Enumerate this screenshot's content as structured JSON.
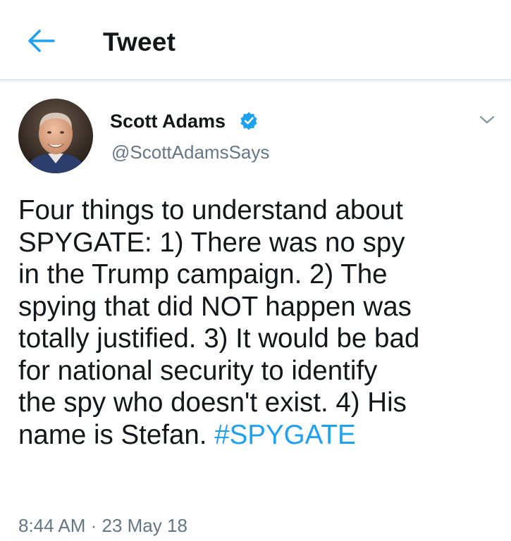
{
  "header": {
    "back_icon": "arrow-left-icon",
    "title": "Tweet",
    "accent_color": "#1da1f2"
  },
  "tweet": {
    "author": {
      "name": "Scott Adams",
      "handle": "@ScottAdamsSays",
      "verified": true,
      "verified_icon": "verified-badge-icon"
    },
    "menu_icon": "chevron-down-icon",
    "text_lines": [
      "Four things to understand about",
      "SPYGATE: 1) There was no spy",
      "in the Trump campaign. 2) The",
      "spying that did NOT happen was",
      "totally justified. 3) It would be bad",
      "for national security to identify",
      "the spy who doesn't exist. 4) His",
      "name is Stefan. "
    ],
    "hashtag": "#SPYGATE",
    "timestamp": "8:44 AM · 23 May 18"
  }
}
